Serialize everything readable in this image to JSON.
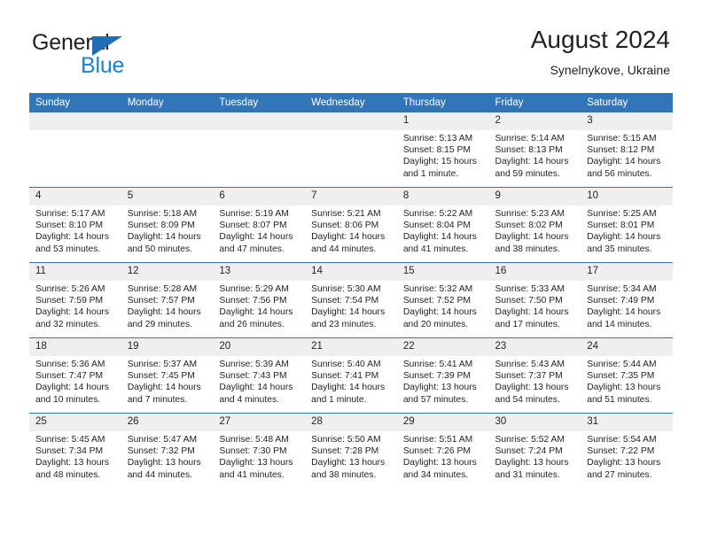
{
  "brand": {
    "name_part1": "General",
    "name_part2": "Blue",
    "accent_color": "#1f7fd0",
    "triangle_color": "#1f6cb4"
  },
  "header": {
    "title": "August 2024",
    "subtitle": "Synelnykove, Ukraine",
    "header_bar_color": "#3275b8",
    "daynum_band_color": "#efeff0"
  },
  "weekdays": [
    "Sunday",
    "Monday",
    "Tuesday",
    "Wednesday",
    "Thursday",
    "Friday",
    "Saturday"
  ],
  "labels": {
    "sunrise": "Sunrise:",
    "sunset": "Sunset:",
    "daylight": "Daylight:"
  },
  "weeks": [
    [
      {
        "day": "",
        "empty": true
      },
      {
        "day": "",
        "empty": true
      },
      {
        "day": "",
        "empty": true
      },
      {
        "day": "",
        "empty": true
      },
      {
        "day": "1",
        "sunrise": "Sunrise: 5:13 AM",
        "sunset": "Sunset: 8:15 PM",
        "daylight": "Daylight: 15 hours and 1 minute."
      },
      {
        "day": "2",
        "sunrise": "Sunrise: 5:14 AM",
        "sunset": "Sunset: 8:13 PM",
        "daylight": "Daylight: 14 hours and 59 minutes."
      },
      {
        "day": "3",
        "sunrise": "Sunrise: 5:15 AM",
        "sunset": "Sunset: 8:12 PM",
        "daylight": "Daylight: 14 hours and 56 minutes."
      }
    ],
    [
      {
        "day": "4",
        "sunrise": "Sunrise: 5:17 AM",
        "sunset": "Sunset: 8:10 PM",
        "daylight": "Daylight: 14 hours and 53 minutes."
      },
      {
        "day": "5",
        "sunrise": "Sunrise: 5:18 AM",
        "sunset": "Sunset: 8:09 PM",
        "daylight": "Daylight: 14 hours and 50 minutes."
      },
      {
        "day": "6",
        "sunrise": "Sunrise: 5:19 AM",
        "sunset": "Sunset: 8:07 PM",
        "daylight": "Daylight: 14 hours and 47 minutes."
      },
      {
        "day": "7",
        "sunrise": "Sunrise: 5:21 AM",
        "sunset": "Sunset: 8:06 PM",
        "daylight": "Daylight: 14 hours and 44 minutes."
      },
      {
        "day": "8",
        "sunrise": "Sunrise: 5:22 AM",
        "sunset": "Sunset: 8:04 PM",
        "daylight": "Daylight: 14 hours and 41 minutes."
      },
      {
        "day": "9",
        "sunrise": "Sunrise: 5:23 AM",
        "sunset": "Sunset: 8:02 PM",
        "daylight": "Daylight: 14 hours and 38 minutes."
      },
      {
        "day": "10",
        "sunrise": "Sunrise: 5:25 AM",
        "sunset": "Sunset: 8:01 PM",
        "daylight": "Daylight: 14 hours and 35 minutes."
      }
    ],
    [
      {
        "day": "11",
        "sunrise": "Sunrise: 5:26 AM",
        "sunset": "Sunset: 7:59 PM",
        "daylight": "Daylight: 14 hours and 32 minutes."
      },
      {
        "day": "12",
        "sunrise": "Sunrise: 5:28 AM",
        "sunset": "Sunset: 7:57 PM",
        "daylight": "Daylight: 14 hours and 29 minutes."
      },
      {
        "day": "13",
        "sunrise": "Sunrise: 5:29 AM",
        "sunset": "Sunset: 7:56 PM",
        "daylight": "Daylight: 14 hours and 26 minutes."
      },
      {
        "day": "14",
        "sunrise": "Sunrise: 5:30 AM",
        "sunset": "Sunset: 7:54 PM",
        "daylight": "Daylight: 14 hours and 23 minutes."
      },
      {
        "day": "15",
        "sunrise": "Sunrise: 5:32 AM",
        "sunset": "Sunset: 7:52 PM",
        "daylight": "Daylight: 14 hours and 20 minutes."
      },
      {
        "day": "16",
        "sunrise": "Sunrise: 5:33 AM",
        "sunset": "Sunset: 7:50 PM",
        "daylight": "Daylight: 14 hours and 17 minutes."
      },
      {
        "day": "17",
        "sunrise": "Sunrise: 5:34 AM",
        "sunset": "Sunset: 7:49 PM",
        "daylight": "Daylight: 14 hours and 14 minutes."
      }
    ],
    [
      {
        "day": "18",
        "sunrise": "Sunrise: 5:36 AM",
        "sunset": "Sunset: 7:47 PM",
        "daylight": "Daylight: 14 hours and 10 minutes."
      },
      {
        "day": "19",
        "sunrise": "Sunrise: 5:37 AM",
        "sunset": "Sunset: 7:45 PM",
        "daylight": "Daylight: 14 hours and 7 minutes."
      },
      {
        "day": "20",
        "sunrise": "Sunrise: 5:39 AM",
        "sunset": "Sunset: 7:43 PM",
        "daylight": "Daylight: 14 hours and 4 minutes."
      },
      {
        "day": "21",
        "sunrise": "Sunrise: 5:40 AM",
        "sunset": "Sunset: 7:41 PM",
        "daylight": "Daylight: 14 hours and 1 minute."
      },
      {
        "day": "22",
        "sunrise": "Sunrise: 5:41 AM",
        "sunset": "Sunset: 7:39 PM",
        "daylight": "Daylight: 13 hours and 57 minutes."
      },
      {
        "day": "23",
        "sunrise": "Sunrise: 5:43 AM",
        "sunset": "Sunset: 7:37 PM",
        "daylight": "Daylight: 13 hours and 54 minutes."
      },
      {
        "day": "24",
        "sunrise": "Sunrise: 5:44 AM",
        "sunset": "Sunset: 7:35 PM",
        "daylight": "Daylight: 13 hours and 51 minutes."
      }
    ],
    [
      {
        "day": "25",
        "sunrise": "Sunrise: 5:45 AM",
        "sunset": "Sunset: 7:34 PM",
        "daylight": "Daylight: 13 hours and 48 minutes."
      },
      {
        "day": "26",
        "sunrise": "Sunrise: 5:47 AM",
        "sunset": "Sunset: 7:32 PM",
        "daylight": "Daylight: 13 hours and 44 minutes."
      },
      {
        "day": "27",
        "sunrise": "Sunrise: 5:48 AM",
        "sunset": "Sunset: 7:30 PM",
        "daylight": "Daylight: 13 hours and 41 minutes."
      },
      {
        "day": "28",
        "sunrise": "Sunrise: 5:50 AM",
        "sunset": "Sunset: 7:28 PM",
        "daylight": "Daylight: 13 hours and 38 minutes."
      },
      {
        "day": "29",
        "sunrise": "Sunrise: 5:51 AM",
        "sunset": "Sunset: 7:26 PM",
        "daylight": "Daylight: 13 hours and 34 minutes."
      },
      {
        "day": "30",
        "sunrise": "Sunrise: 5:52 AM",
        "sunset": "Sunset: 7:24 PM",
        "daylight": "Daylight: 13 hours and 31 minutes."
      },
      {
        "day": "31",
        "sunrise": "Sunrise: 5:54 AM",
        "sunset": "Sunset: 7:22 PM",
        "daylight": "Daylight: 13 hours and 27 minutes."
      }
    ]
  ]
}
